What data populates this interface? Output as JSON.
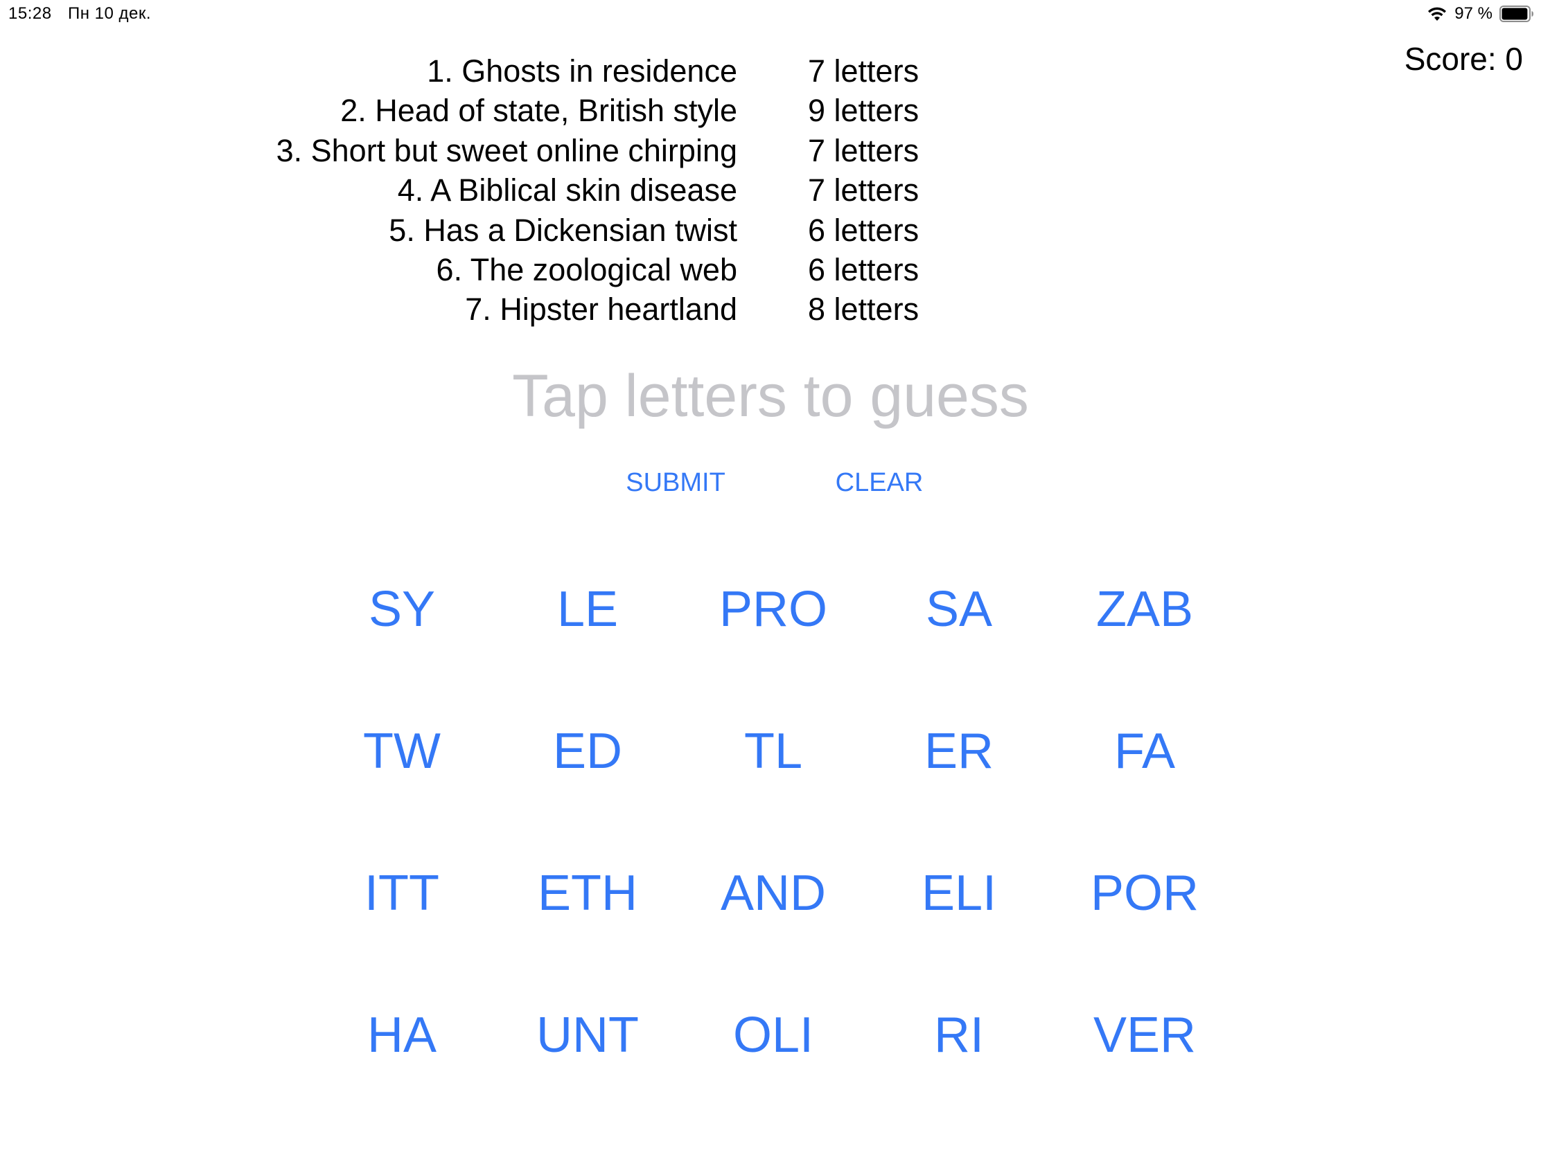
{
  "status_bar": {
    "time": "15:28",
    "date": "Пн 10 дек.",
    "battery_percent": "97 %",
    "battery_level": 0.97,
    "wifi_icon": "wifi-icon",
    "battery_icon": "battery-icon"
  },
  "score": {
    "label": "Score: 0"
  },
  "clues": [
    {
      "text": "1. Ghosts in residence",
      "length": "7 letters"
    },
    {
      "text": "2. Head of state, British style",
      "length": "9 letters"
    },
    {
      "text": "3. Short but sweet online chirping",
      "length": "7 letters"
    },
    {
      "text": "4. A Biblical skin disease",
      "length": "7 letters"
    },
    {
      "text": "5. Has a Dickensian twist",
      "length": "6 letters"
    },
    {
      "text": "6. The zoological web",
      "length": "6 letters"
    },
    {
      "text": "7. Hipster heartland",
      "length": "8 letters"
    }
  ],
  "guess": {
    "placeholder": "Tap letters to guess"
  },
  "actions": {
    "submit_label": "SUBMIT",
    "clear_label": "CLEAR"
  },
  "tiles": [
    [
      "SY",
      "LE",
      "PRO",
      "SA",
      "ZAB"
    ],
    [
      "TW",
      "ED",
      "TL",
      "ER",
      "FA"
    ],
    [
      "ITT",
      "ETH",
      "AND",
      "ELI",
      "POR"
    ],
    [
      "HA",
      "UNT",
      "OLI",
      "RI",
      "VER"
    ]
  ],
  "colors": {
    "accent": "#3478f6",
    "placeholder": "#c5c5c9",
    "text": "#000000",
    "background": "#ffffff"
  }
}
